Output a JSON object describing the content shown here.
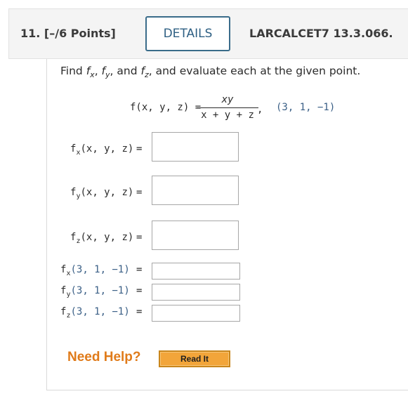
{
  "header": {
    "question_number": "11. [–/6 Points]",
    "details_label": "DETAILS",
    "code": "LARCALCET7 13.3.066."
  },
  "instruction": {
    "find": "Find",
    "fx": "f",
    "fx_sub": "x",
    "fy": "f",
    "fy_sub": "y",
    "and": "and",
    "fz": "f",
    "fz_sub": "z",
    "rest": ", and evaluate each at the given point."
  },
  "function": {
    "lhs": "f(x, y, z)  =",
    "numerator": "xy",
    "denominator": "x + y + z",
    "comma": ",",
    "point": "(3, 1, −1)"
  },
  "partials": [
    {
      "f": "f",
      "sub": "x",
      "args": "(x, y, z)",
      "eq": "="
    },
    {
      "f": "f",
      "sub": "y",
      "args": "(x, y, z)",
      "eq": "="
    },
    {
      "f": "f",
      "sub": "z",
      "args": "(x, y, z)",
      "eq": "="
    }
  ],
  "evaluations": [
    {
      "f": "f",
      "sub": "x",
      "args": "(3, 1, −1)",
      "eq": "="
    },
    {
      "f": "f",
      "sub": "y",
      "args": "(3, 1, −1)",
      "eq": "="
    },
    {
      "f": "f",
      "sub": "z",
      "args": "(3, 1, −1)",
      "eq": "="
    }
  ],
  "inputs": {
    "fx": "",
    "fy": "",
    "fz": "",
    "fx_eval": "",
    "fy_eval": "",
    "fz_eval": ""
  },
  "help": {
    "label": "Need Help?",
    "read_it": "Read It"
  },
  "colors": {
    "accent_orange": "#e07b1a",
    "point_blue": "#3a5f86",
    "details_border": "#3a6c8a"
  }
}
